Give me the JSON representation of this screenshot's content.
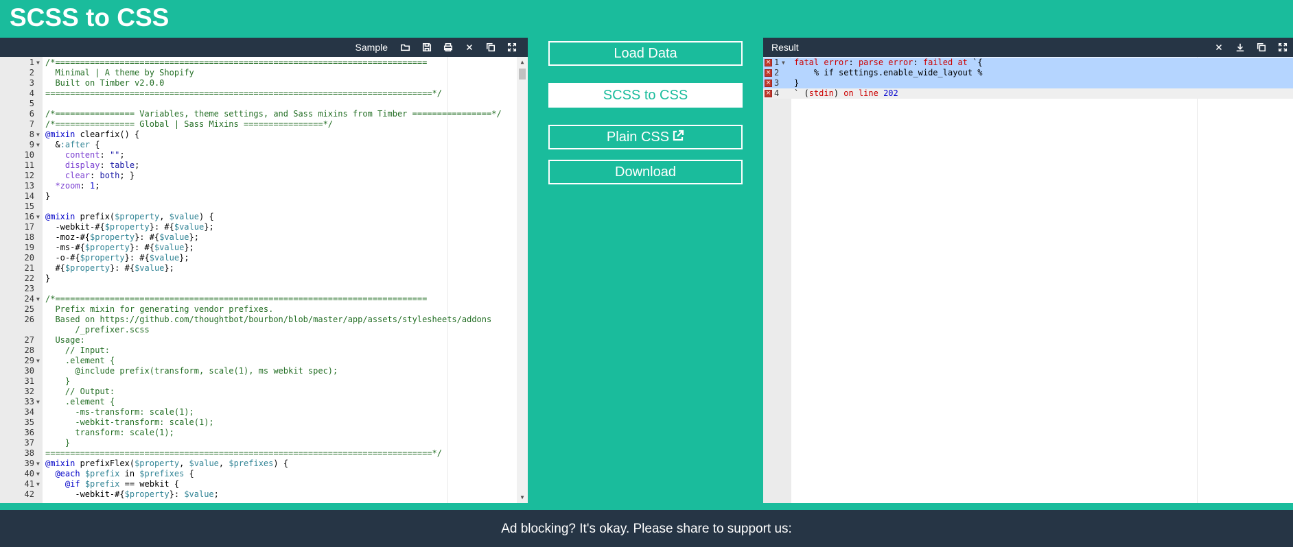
{
  "app": {
    "title": "SCSS to CSS"
  },
  "left_panel": {
    "title": "Sample",
    "icons": [
      "folder-open-icon",
      "save-icon",
      "print-icon",
      "close-icon",
      "copy-icon",
      "fullscreen-icon"
    ]
  },
  "right_panel": {
    "title": "Result",
    "icons": [
      "close-icon",
      "download-icon",
      "copy-icon",
      "fullscreen-icon"
    ]
  },
  "buttons": {
    "load_data": "Load Data",
    "scss_to_css": "SCSS to CSS",
    "plain_css": "Plain CSS",
    "download": "Download"
  },
  "source_lines": [
    {
      "n": "1",
      "fold": true,
      "parts": [
        [
          "c-comment",
          "/*==========================================================================="
        ]
      ]
    },
    {
      "n": "2",
      "parts": [
        [
          "c-comment",
          "  Minimal | A theme by Shopify"
        ]
      ]
    },
    {
      "n": "3",
      "parts": [
        [
          "c-comment",
          "  Built on Timber v2.0.0"
        ]
      ]
    },
    {
      "n": "4",
      "parts": [
        [
          "c-comment",
          "==============================================================================*/"
        ]
      ]
    },
    {
      "n": "5",
      "parts": []
    },
    {
      "n": "6",
      "parts": [
        [
          "c-comment",
          "/*================ Variables, theme settings, and Sass mixins from Timber ================*/"
        ]
      ]
    },
    {
      "n": "7",
      "parts": [
        [
          "c-comment",
          "/*================ Global | Sass Mixins ================*/"
        ]
      ]
    },
    {
      "n": "8",
      "fold": true,
      "parts": [
        [
          "c-kw",
          "@mixin"
        ],
        [
          "c-plain",
          " clearfix() {"
        ]
      ]
    },
    {
      "n": "9",
      "fold": true,
      "parts": [
        [
          "c-plain",
          "  &"
        ],
        [
          "c-var",
          ":after"
        ],
        [
          "c-plain",
          " {"
        ]
      ]
    },
    {
      "n": "10",
      "parts": [
        [
          "c-prop",
          "    content"
        ],
        [
          "c-plain",
          ": "
        ],
        [
          "c-str",
          "\"\""
        ],
        [
          "c-plain",
          ";"
        ]
      ]
    },
    {
      "n": "11",
      "parts": [
        [
          "c-prop",
          "    display"
        ],
        [
          "c-plain",
          ": "
        ],
        [
          "c-str",
          "table"
        ],
        [
          "c-plain",
          ";"
        ]
      ]
    },
    {
      "n": "12",
      "parts": [
        [
          "c-prop",
          "    clear"
        ],
        [
          "c-plain",
          ": "
        ],
        [
          "c-str",
          "both"
        ],
        [
          "c-plain",
          "; }"
        ]
      ]
    },
    {
      "n": "13",
      "parts": [
        [
          "c-prop",
          "  *zoom"
        ],
        [
          "c-plain",
          ": "
        ],
        [
          "c-num",
          "1"
        ],
        [
          "c-plain",
          ";"
        ]
      ]
    },
    {
      "n": "14",
      "parts": [
        [
          "c-plain",
          "}"
        ]
      ]
    },
    {
      "n": "15",
      "parts": []
    },
    {
      "n": "16",
      "fold": true,
      "parts": [
        [
          "c-kw",
          "@mixin"
        ],
        [
          "c-plain",
          " prefix("
        ],
        [
          "c-var",
          "$property"
        ],
        [
          "c-plain",
          ", "
        ],
        [
          "c-var",
          "$value"
        ],
        [
          "c-plain",
          ") {"
        ]
      ]
    },
    {
      "n": "17",
      "parts": [
        [
          "c-plain",
          "  -webkit-#{"
        ],
        [
          "c-var",
          "$property"
        ],
        [
          "c-plain",
          "}: #{"
        ],
        [
          "c-var",
          "$value"
        ],
        [
          "c-plain",
          "};"
        ]
      ]
    },
    {
      "n": "18",
      "parts": [
        [
          "c-plain",
          "  -moz-#{"
        ],
        [
          "c-var",
          "$property"
        ],
        [
          "c-plain",
          "}: #{"
        ],
        [
          "c-var",
          "$value"
        ],
        [
          "c-plain",
          "};"
        ]
      ]
    },
    {
      "n": "19",
      "parts": [
        [
          "c-plain",
          "  -ms-#{"
        ],
        [
          "c-var",
          "$property"
        ],
        [
          "c-plain",
          "}: #{"
        ],
        [
          "c-var",
          "$value"
        ],
        [
          "c-plain",
          "};"
        ]
      ]
    },
    {
      "n": "20",
      "parts": [
        [
          "c-plain",
          "  -o-#{"
        ],
        [
          "c-var",
          "$property"
        ],
        [
          "c-plain",
          "}: #{"
        ],
        [
          "c-var",
          "$value"
        ],
        [
          "c-plain",
          "};"
        ]
      ]
    },
    {
      "n": "21",
      "parts": [
        [
          "c-plain",
          "  #{"
        ],
        [
          "c-var",
          "$property"
        ],
        [
          "c-plain",
          "}: #{"
        ],
        [
          "c-var",
          "$value"
        ],
        [
          "c-plain",
          "};"
        ]
      ]
    },
    {
      "n": "22",
      "parts": [
        [
          "c-plain",
          "}"
        ]
      ]
    },
    {
      "n": "23",
      "parts": []
    },
    {
      "n": "24",
      "fold": true,
      "parts": [
        [
          "c-comment",
          "/*==========================================================================="
        ]
      ]
    },
    {
      "n": "25",
      "parts": [
        [
          "c-comment",
          "  Prefix mixin for generating vendor prefixes."
        ]
      ]
    },
    {
      "n": "26",
      "parts": [
        [
          "c-comment",
          "  Based on https://github.com/thoughtbot/bourbon/blob/master/app/assets/stylesheets/addons"
        ]
      ]
    },
    {
      "n": "",
      "parts": [
        [
          "c-comment",
          "      /_prefixer.scss"
        ]
      ]
    },
    {
      "n": "27",
      "parts": [
        [
          "c-comment",
          "  Usage:"
        ]
      ]
    },
    {
      "n": "28",
      "parts": [
        [
          "c-comment",
          "    // Input:"
        ]
      ]
    },
    {
      "n": "29",
      "fold": true,
      "parts": [
        [
          "c-comment",
          "    .element {"
        ]
      ]
    },
    {
      "n": "30",
      "parts": [
        [
          "c-comment",
          "      @include prefix(transform, scale(1), ms webkit spec);"
        ]
      ]
    },
    {
      "n": "31",
      "parts": [
        [
          "c-comment",
          "    }"
        ]
      ]
    },
    {
      "n": "32",
      "parts": [
        [
          "c-comment",
          "    // Output:"
        ]
      ]
    },
    {
      "n": "33",
      "fold": true,
      "parts": [
        [
          "c-comment",
          "    .element {"
        ]
      ]
    },
    {
      "n": "34",
      "parts": [
        [
          "c-comment",
          "      -ms-transform: scale(1);"
        ]
      ]
    },
    {
      "n": "35",
      "parts": [
        [
          "c-comment",
          "      -webkit-transform: scale(1);"
        ]
      ]
    },
    {
      "n": "36",
      "parts": [
        [
          "c-comment",
          "      transform: scale(1);"
        ]
      ]
    },
    {
      "n": "37",
      "parts": [
        [
          "c-comment",
          "    }"
        ]
      ]
    },
    {
      "n": "38",
      "parts": [
        [
          "c-comment",
          "==============================================================================*/"
        ]
      ]
    },
    {
      "n": "39",
      "fold": true,
      "parts": [
        [
          "c-kw",
          "@mixin"
        ],
        [
          "c-plain",
          " prefixFlex("
        ],
        [
          "c-var",
          "$property"
        ],
        [
          "c-plain",
          ", "
        ],
        [
          "c-var",
          "$value"
        ],
        [
          "c-plain",
          ", "
        ],
        [
          "c-var",
          "$prefixes"
        ],
        [
          "c-plain",
          ") {"
        ]
      ]
    },
    {
      "n": "40",
      "fold": true,
      "parts": [
        [
          "c-kw",
          "  @each"
        ],
        [
          "c-plain",
          " "
        ],
        [
          "c-var",
          "$prefix"
        ],
        [
          "c-plain",
          " in "
        ],
        [
          "c-var",
          "$prefixes"
        ],
        [
          "c-plain",
          " {"
        ]
      ]
    },
    {
      "n": "41",
      "fold": true,
      "parts": [
        [
          "c-kw",
          "    @if"
        ],
        [
          "c-plain",
          " "
        ],
        [
          "c-var",
          "$prefix"
        ],
        [
          "c-plain",
          " == webkit {"
        ]
      ]
    },
    {
      "n": "42",
      "parts": [
        [
          "c-plain",
          "      -webkit-#{"
        ],
        [
          "c-var",
          "$property"
        ],
        [
          "c-plain",
          "}: "
        ],
        [
          "c-var",
          "$value"
        ],
        [
          "c-plain",
          ";"
        ]
      ]
    }
  ],
  "result_lines": [
    {
      "n": "1",
      "fold": true,
      "error": true,
      "hl": true,
      "parts": [
        [
          "c-err",
          "fatal error"
        ],
        [
          "c-plain",
          ": "
        ],
        [
          "c-err",
          "parse error"
        ],
        [
          "c-plain",
          ": "
        ],
        [
          "c-err",
          "failed at"
        ],
        [
          "c-plain",
          " `{"
        ]
      ]
    },
    {
      "n": "2",
      "error": true,
      "hl": true,
      "parts": [
        [
          "c-plain",
          "    % if settings.enable_wide_layout %"
        ]
      ]
    },
    {
      "n": "3",
      "error": true,
      "hl": true,
      "parts": [
        [
          "c-plain",
          "}"
        ]
      ]
    },
    {
      "n": "4",
      "error": true,
      "cur": true,
      "parts": [
        [
          "c-plain",
          "` ("
        ],
        [
          "c-err",
          "stdin"
        ],
        [
          "c-plain",
          ") "
        ],
        [
          "c-err",
          "on line"
        ],
        [
          "c-plain",
          " "
        ],
        [
          "c-num",
          "202"
        ]
      ]
    }
  ],
  "footer": {
    "share_text": "Ad blocking? It's okay. Please share to support us:"
  }
}
